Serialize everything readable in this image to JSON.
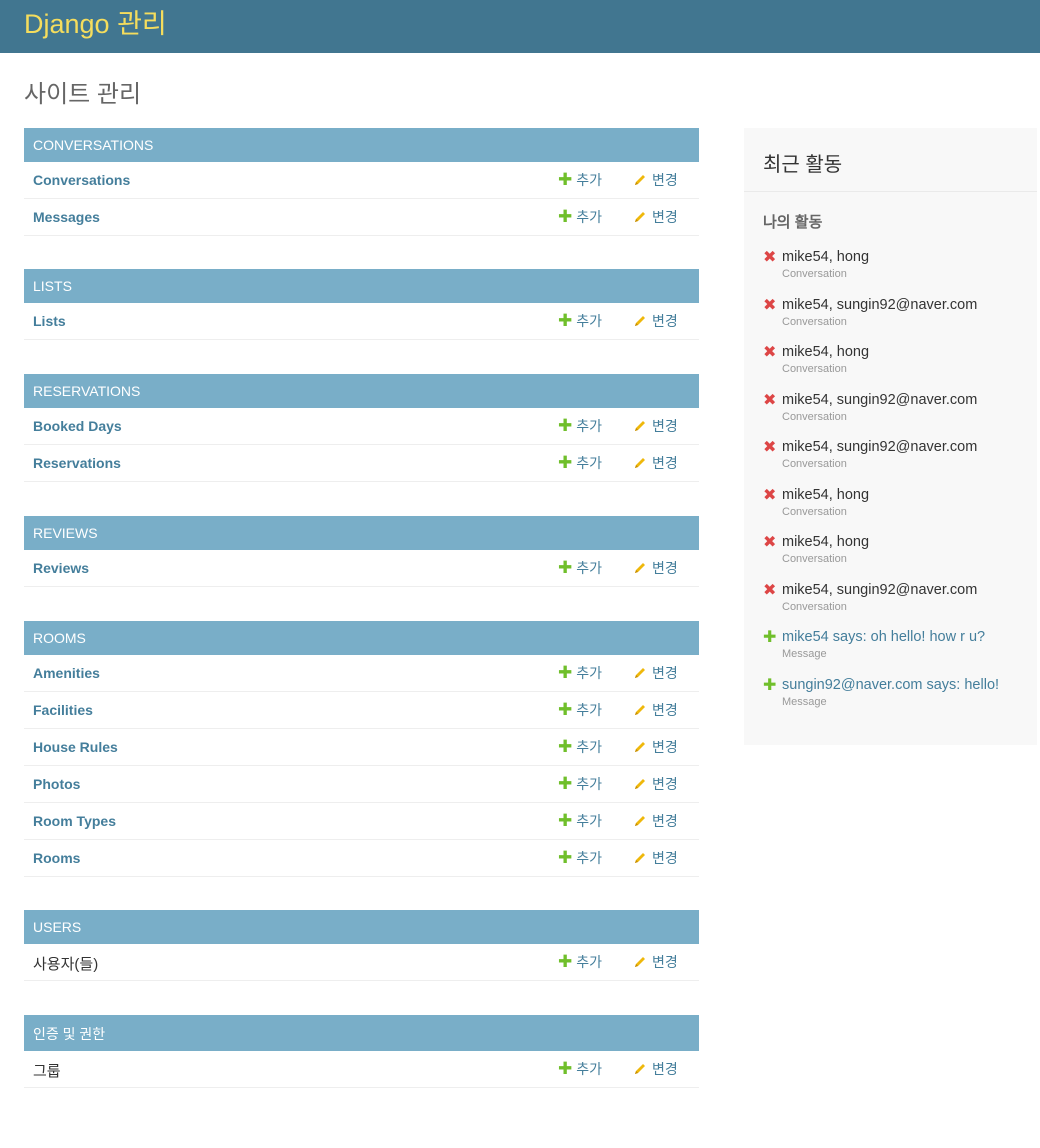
{
  "header": {
    "site_name": "Django 관리"
  },
  "page_title": "사이트 관리",
  "add_label": "추가",
  "change_label": "변경",
  "modules": [
    {
      "caption": "CONVERSATIONS",
      "models": [
        "Conversations",
        "Messages"
      ]
    },
    {
      "caption": "LISTS",
      "models": [
        "Lists"
      ]
    },
    {
      "caption": "RESERVATIONS",
      "models": [
        "Booked Days",
        "Reservations"
      ]
    },
    {
      "caption": "REVIEWS",
      "models": [
        "Reviews"
      ]
    },
    {
      "caption": "ROOMS",
      "models": [
        "Amenities",
        "Facilities",
        "House Rules",
        "Photos",
        "Room Types",
        "Rooms"
      ]
    },
    {
      "caption": "USERS",
      "models": [
        "사용자(들)"
      ]
    },
    {
      "caption": "인증 및 권한",
      "models": [
        "그룹"
      ]
    }
  ],
  "recent": {
    "title": "최근 활동",
    "my_actions": "나의 활동",
    "items": [
      {
        "text": "mike54, hong",
        "type": "Conversation",
        "action": "delete"
      },
      {
        "text": "mike54, sungin92@naver.com",
        "type": "Conversation",
        "action": "delete"
      },
      {
        "text": "mike54, hong",
        "type": "Conversation",
        "action": "delete"
      },
      {
        "text": "mike54, sungin92@naver.com",
        "type": "Conversation",
        "action": "delete"
      },
      {
        "text": "mike54, sungin92@naver.com",
        "type": "Conversation",
        "action": "delete"
      },
      {
        "text": "mike54, hong",
        "type": "Conversation",
        "action": "delete"
      },
      {
        "text": "mike54, hong",
        "type": "Conversation",
        "action": "delete"
      },
      {
        "text": "mike54, sungin92@naver.com",
        "type": "Conversation",
        "action": "delete"
      },
      {
        "text": "mike54 says: oh hello! how r u?",
        "type": "Message",
        "action": "add"
      },
      {
        "text": "sungin92@naver.com says: hello!",
        "type": "Message",
        "action": "add"
      }
    ]
  },
  "colors": {
    "header_bg": "#417690",
    "site_name": "#f5dd5d",
    "caption_bg": "#79aec8",
    "link": "#447e9b",
    "add_icon": "#70bf2b",
    "change_icon": "#efb80b",
    "delete_icon": "#dd4646"
  }
}
